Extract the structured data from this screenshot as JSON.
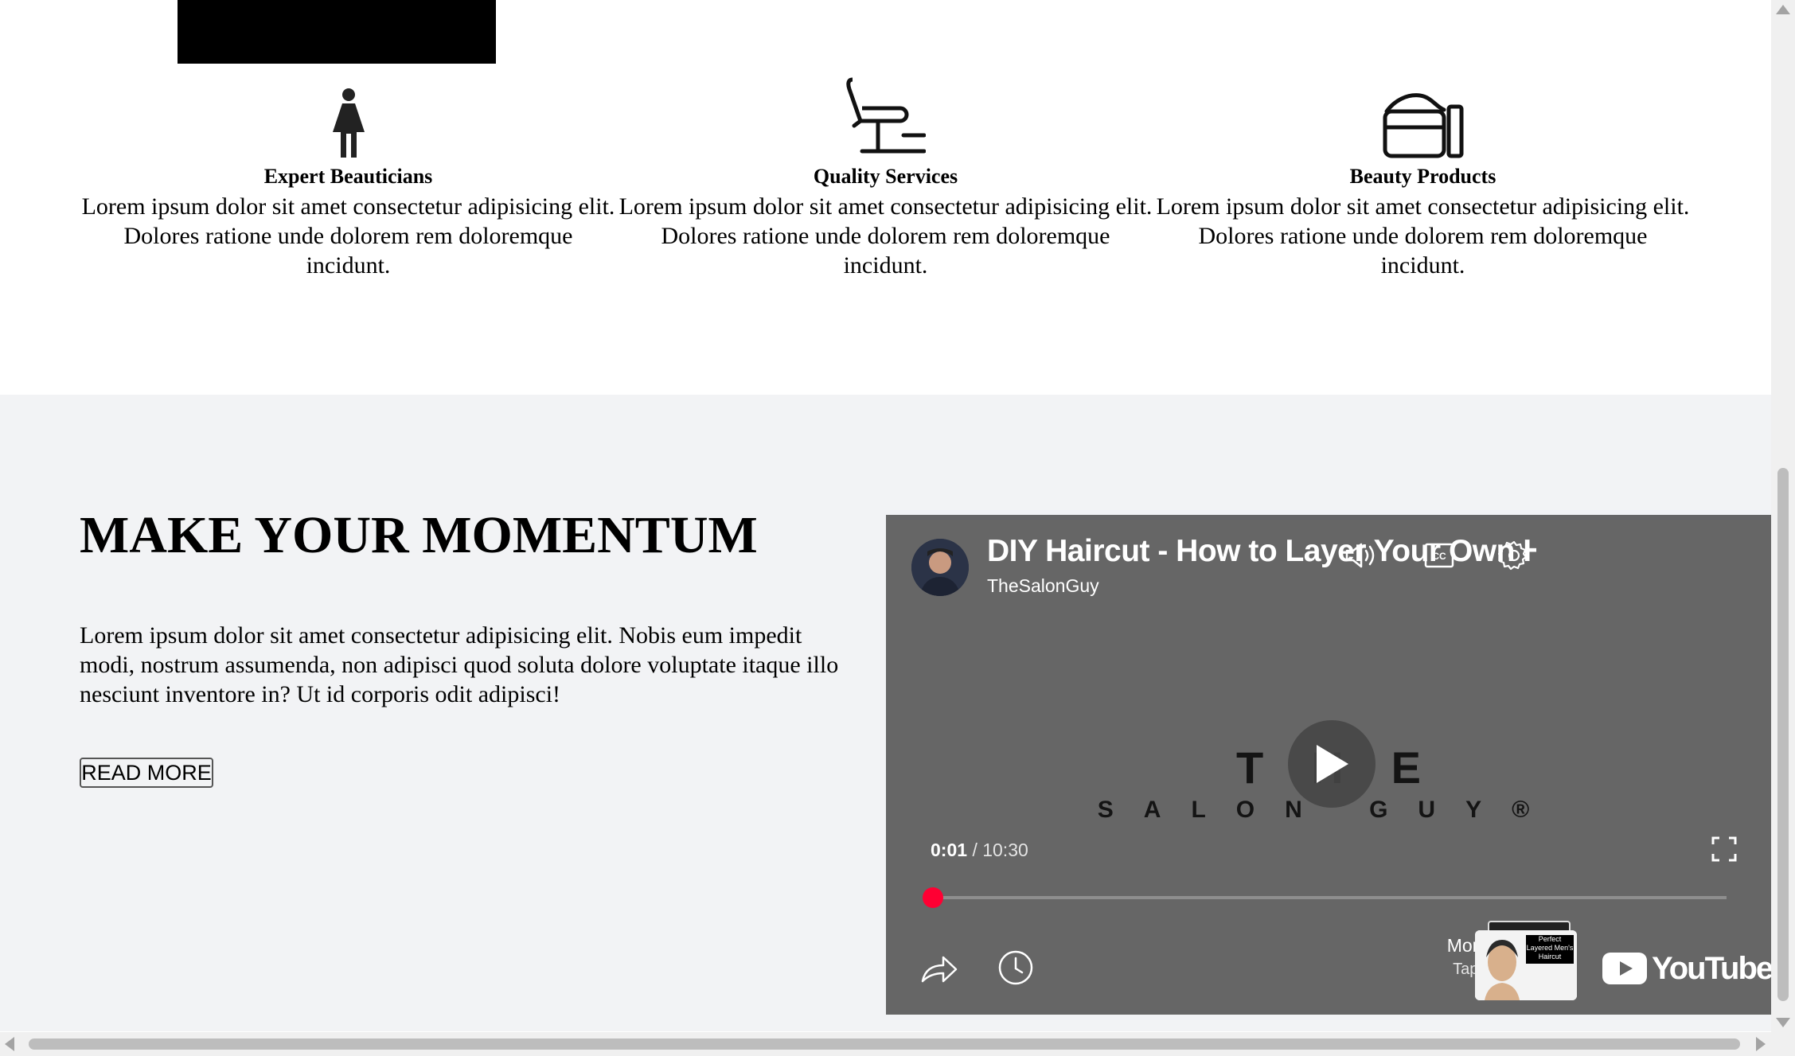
{
  "features": [
    {
      "title": "Expert Beauticians",
      "text": "Lorem ipsum dolor sit amet consectetur adipisicing elit. Dolores ratione unde dolorem rem doloremque incidunt.",
      "icon": "woman-icon"
    },
    {
      "title": "Quality Services",
      "text": "Lorem ipsum dolor sit amet consectetur adipisicing elit. Dolores ratione unde dolorem rem doloremque incidunt.",
      "icon": "salon-chair-icon"
    },
    {
      "title": "Beauty Products",
      "text": "Lorem ipsum dolor sit amet consectetur adipisicing elit. Dolores ratione unde dolorem rem doloremque incidunt.",
      "icon": "cream-jar-icon"
    }
  ],
  "momentum": {
    "heading": "MAKE YOUR MOMENTUM",
    "body": "Lorem ipsum dolor sit amet consectetur adipisicing elit. Nobis eum impedit modi, nostrum assumenda, non adipisci quod soluta dolore voluptate itaque illo nesciunt inventore in? Ut id corporis odit adipisci!",
    "button_label": "READ MORE"
  },
  "video": {
    "title": "DIY Haircut - How to Layer Your Own Hair",
    "channel": "TheSalonGuy",
    "brand_line1": "THE",
    "brand_line2": "SALON GUY®",
    "current_time": "0:01",
    "separator": "/",
    "duration": "10:30",
    "progress_fraction": 0.002,
    "more_videos": "More videos",
    "more_videos_sub": "Tap to see all",
    "thumb_caption": "Perfect Layered Men's Haircut",
    "youtube_label": "YouTube",
    "progress_color": "#ff0000"
  },
  "colors": {
    "section_bg": "#f2f3f5",
    "player_bg": "#666666"
  }
}
